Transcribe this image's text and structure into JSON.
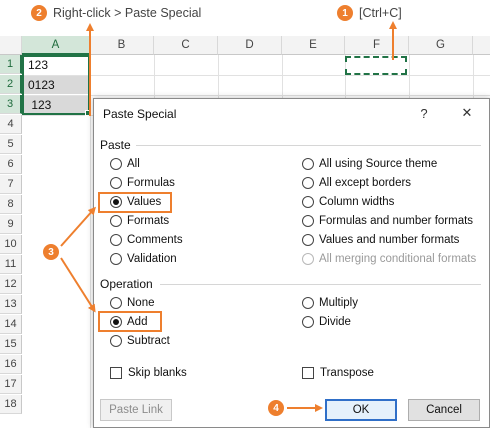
{
  "annotations": {
    "step1_badge": "1",
    "step1_text": "[Ctrl+C]",
    "step2_badge": "2",
    "step2_text": "Right-click > Paste Special",
    "step3_badge": "3",
    "step4_badge": "4"
  },
  "sheet": {
    "columns": [
      "A",
      "B",
      "C",
      "D",
      "E",
      "F",
      "G"
    ],
    "rows": [
      "1",
      "2",
      "3",
      "4",
      "5",
      "6",
      "7",
      "8",
      "9",
      "10",
      "11",
      "12",
      "13",
      "14",
      "15",
      "16",
      "17",
      "18"
    ],
    "cells": {
      "A1": "123",
      "A2": "0123",
      "A3": " 123"
    }
  },
  "dialog": {
    "title": "Paste Special",
    "help_glyph": "?",
    "close_glyph": "✕",
    "paste_label": "Paste",
    "paste_options_left": [
      "All",
      "Formulas",
      "Values",
      "Formats",
      "Comments",
      "Validation"
    ],
    "paste_options_right": [
      "All using Source theme",
      "All except borders",
      "Column widths",
      "Formulas and number formats",
      "Values and number formats",
      "All merging conditional formats"
    ],
    "paste_selected": "Values",
    "operation_label": "Operation",
    "operation_left": [
      "None",
      "Add",
      "Subtract"
    ],
    "operation_right": [
      "Multiply",
      "Divide"
    ],
    "operation_selected": "Add",
    "skip_blanks": "Skip blanks",
    "transpose": "Transpose",
    "paste_link": "Paste Link",
    "ok": "OK",
    "cancel": "Cancel"
  },
  "colors": {
    "accent": "#ee7f2e",
    "excel_green": "#217346",
    "ok_border": "#2f6fc8"
  }
}
